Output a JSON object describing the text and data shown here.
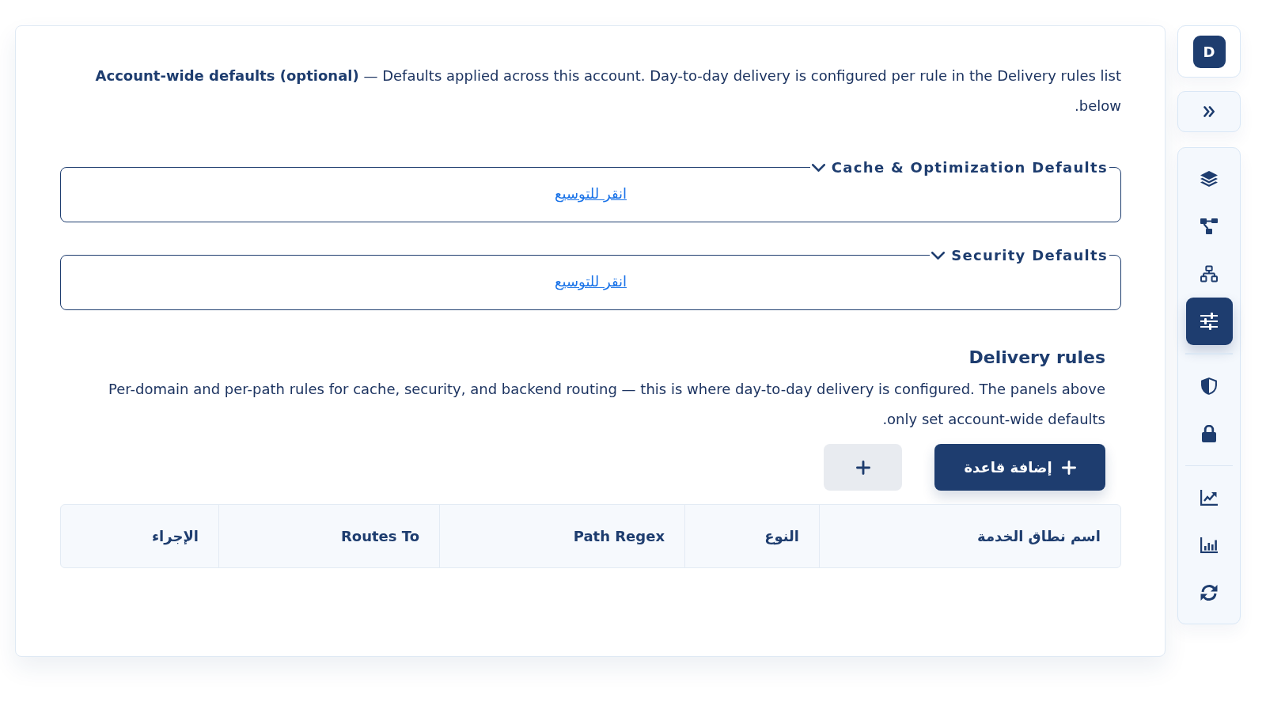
{
  "intro": "**Account-wide defaults (optional)** — Defaults applied across this account. Day-to-day delivery is configured per rule in the Delivery rules list below.",
  "sections": [
    {
      "legend": "Cache & Optimization Defaults",
      "expanded": false,
      "link": "انقر للتوسيع"
    },
    {
      "legend": "Security Defaults",
      "expanded": false,
      "link": "انقر للتوسيع"
    }
  ],
  "delivery_rules": {
    "title": "Delivery rules",
    "description": "Per-domain and per-path rules for cache, security, and backend routing — this is where day-to-day delivery is configured. The panels above only set account-wide defaults.",
    "buttons": [
      {
        "kind": "primary",
        "label": "إضافة قاعدة"
      },
      {
        "kind": "icon"
      }
    ],
    "table": {
      "columns": [
        "اسم نطاق الخدمة",
        "النوع",
        "Path Regex",
        "Routes To",
        "الإجراء"
      ]
    }
  },
  "sidebar": {
    "avatar": "D",
    "nav_groups": [
      {
        "items": [
          {
            "selected": false
          },
          {
            "selected": false
          },
          {
            "selected": false
          },
          {
            "selected": true
          }
        ]
      },
      {
        "items": [
          {
            "selected": false
          },
          {
            "selected": false
          }
        ]
      },
      {
        "items": [
          {
            "selected": false
          },
          {
            "selected": false
          },
          {
            "selected": false
          }
        ]
      }
    ]
  }
}
